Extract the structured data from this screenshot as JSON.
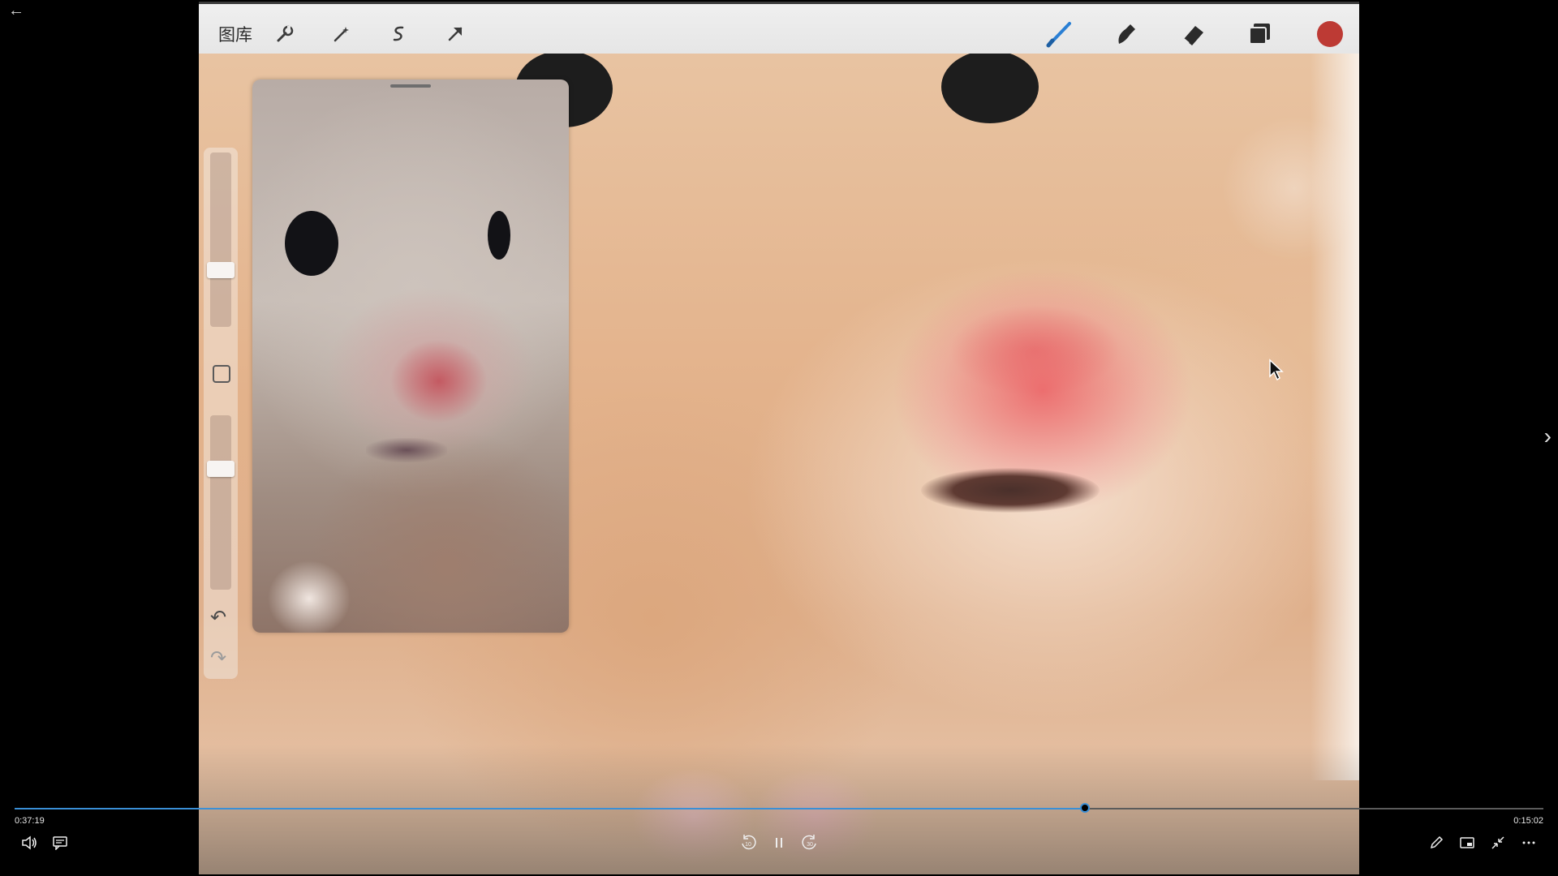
{
  "app": {
    "gallery_label": "图库"
  },
  "toolbar": {
    "left_tools": [
      "wrench-icon",
      "magic-wand-icon",
      "selection-icon",
      "transform-arrow-icon"
    ],
    "right_tools": [
      "brush-icon",
      "smudge-icon",
      "eraser-icon",
      "layers-icon"
    ],
    "color_swatch": "#bd3a34",
    "brush_accent": "#2a7fd4"
  },
  "side_bar": {
    "size_level": 0.35,
    "opacity_level": 0.26
  },
  "player": {
    "current_time": "0:37:19",
    "total_time": "0:15:02",
    "progress": 0.7,
    "accent": "#3a8fd6"
  },
  "controls": {
    "left": [
      "volume-icon",
      "subtitles-icon"
    ],
    "center": [
      "rewind-10-icon",
      "pause-icon",
      "forward-30-icon"
    ],
    "center_labels": {
      "rewind": "10",
      "forward": "30"
    },
    "right": [
      "edit-pencil-icon",
      "mini-player-icon",
      "exit-fullscreen-icon",
      "more-options-icon"
    ]
  }
}
